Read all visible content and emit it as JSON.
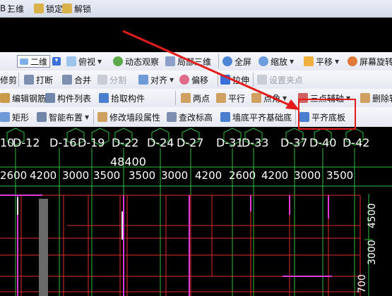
{
  "toolbar_row1": {
    "partial_left": "B",
    "items": [
      "三维",
      "锁定",
      "解锁"
    ]
  },
  "toolbar_row2": {
    "view_select": "二维",
    "items": [
      "俯视",
      "动态观察",
      "局部三维",
      "全屏",
      "缩放",
      "平移",
      "屏幕旋转"
    ]
  },
  "toolbar_row3": {
    "items": [
      "修剪",
      "打断",
      "合并",
      "分割",
      "对齐",
      "偏移",
      "拉伸",
      "设置夹点"
    ]
  },
  "toolbar_row4": {
    "items": [
      "编辑钢筋",
      "构件列表",
      "拾取构件",
      "两点",
      "平行",
      "点角",
      "三点辅轴",
      "删除辅"
    ]
  },
  "toolbar_row5": {
    "items": [
      "矩形",
      "智能布置",
      "修改墙段属性",
      "查改标高",
      "墙底平齐基础底",
      "平齐底板"
    ]
  },
  "cad": {
    "axis_labels": [
      "10",
      "D-12",
      "D-16",
      "D-19",
      "D-22",
      "D-24",
      "D-27",
      "D-31",
      "D-33",
      "D-37",
      "D-40",
      "D-42"
    ],
    "total_dim": "48400",
    "dims": [
      "2600",
      "4200",
      "3000",
      "3500",
      "3500",
      "3000",
      "4200",
      "2600",
      "4200",
      "3000",
      "3500"
    ],
    "right_dims": [
      "4500",
      "3000",
      "700"
    ]
  },
  "annotation": {
    "arrow_color": "#e31b1b",
    "target": "平齐底板"
  }
}
